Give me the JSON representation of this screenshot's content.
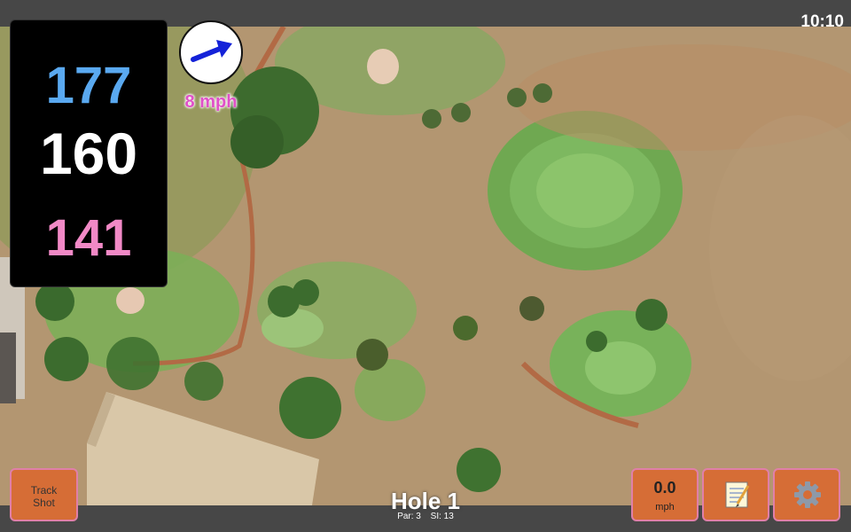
{
  "status_bar": {
    "time": "10:10"
  },
  "distances": {
    "back": "177",
    "center": "160",
    "front": "141"
  },
  "wind": {
    "speed_label": "8 mph",
    "direction_icon": "arrow-icon"
  },
  "hole": {
    "title": "Hole 1",
    "par": "Par: 3",
    "stroke_index": "SI: 13"
  },
  "buttons": {
    "track_shot": {
      "line1": "Track",
      "line2": "Shot"
    },
    "wind_entry": {
      "value": "0.0",
      "unit": "mph"
    },
    "notes": {
      "icon": "notepad-icon"
    },
    "settings": {
      "icon": "gear-icon"
    }
  },
  "colors": {
    "back": "#5aa9f0",
    "center": "#ffffff",
    "front": "#f189c6",
    "button": "#d66d36",
    "wind_text": "#e050c8"
  }
}
